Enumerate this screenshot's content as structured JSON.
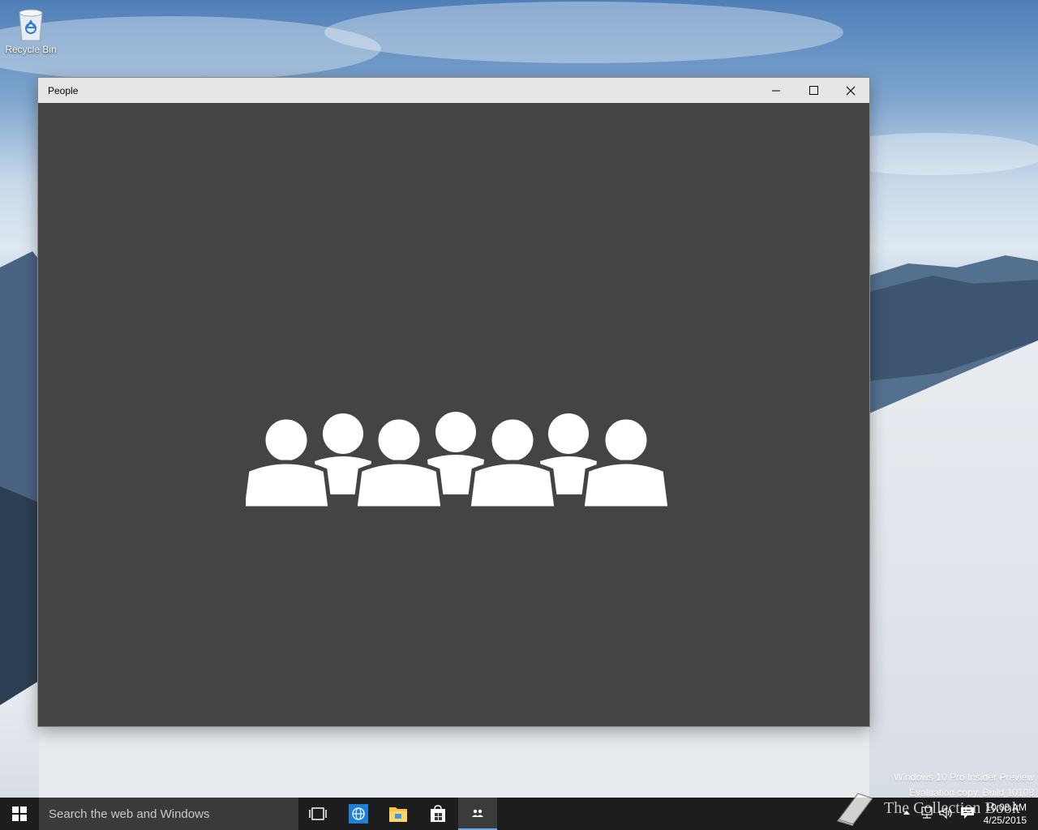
{
  "desktop": {
    "icons": [
      {
        "label": "Recycle Bin",
        "icon": "recycle-bin-icon"
      }
    ],
    "watermark": {
      "line1": "Windows 10 Pro Insider Preview",
      "line2": "Evaluation copy. Build 10108"
    },
    "overlay_logo_text": "The Collection Book"
  },
  "window": {
    "title": "People",
    "controls": {
      "minimize": "minimize-icon",
      "maximize": "maximize-icon",
      "close": "close-icon"
    },
    "splash_icon": "people-group-icon",
    "background_color": "#444444"
  },
  "taskbar": {
    "search_placeholder": "Search the web and Windows",
    "pinned": [
      {
        "name": "task-view",
        "icon": "task-view-icon"
      },
      {
        "name": "browser",
        "icon": "globe-icon"
      },
      {
        "name": "file-explorer",
        "icon": "folder-icon"
      },
      {
        "name": "store",
        "icon": "store-bag-icon"
      },
      {
        "name": "people",
        "icon": "people-icon",
        "active": true
      }
    ],
    "clock": {
      "time": "10:08 AM",
      "date": "4/25/2015"
    }
  }
}
